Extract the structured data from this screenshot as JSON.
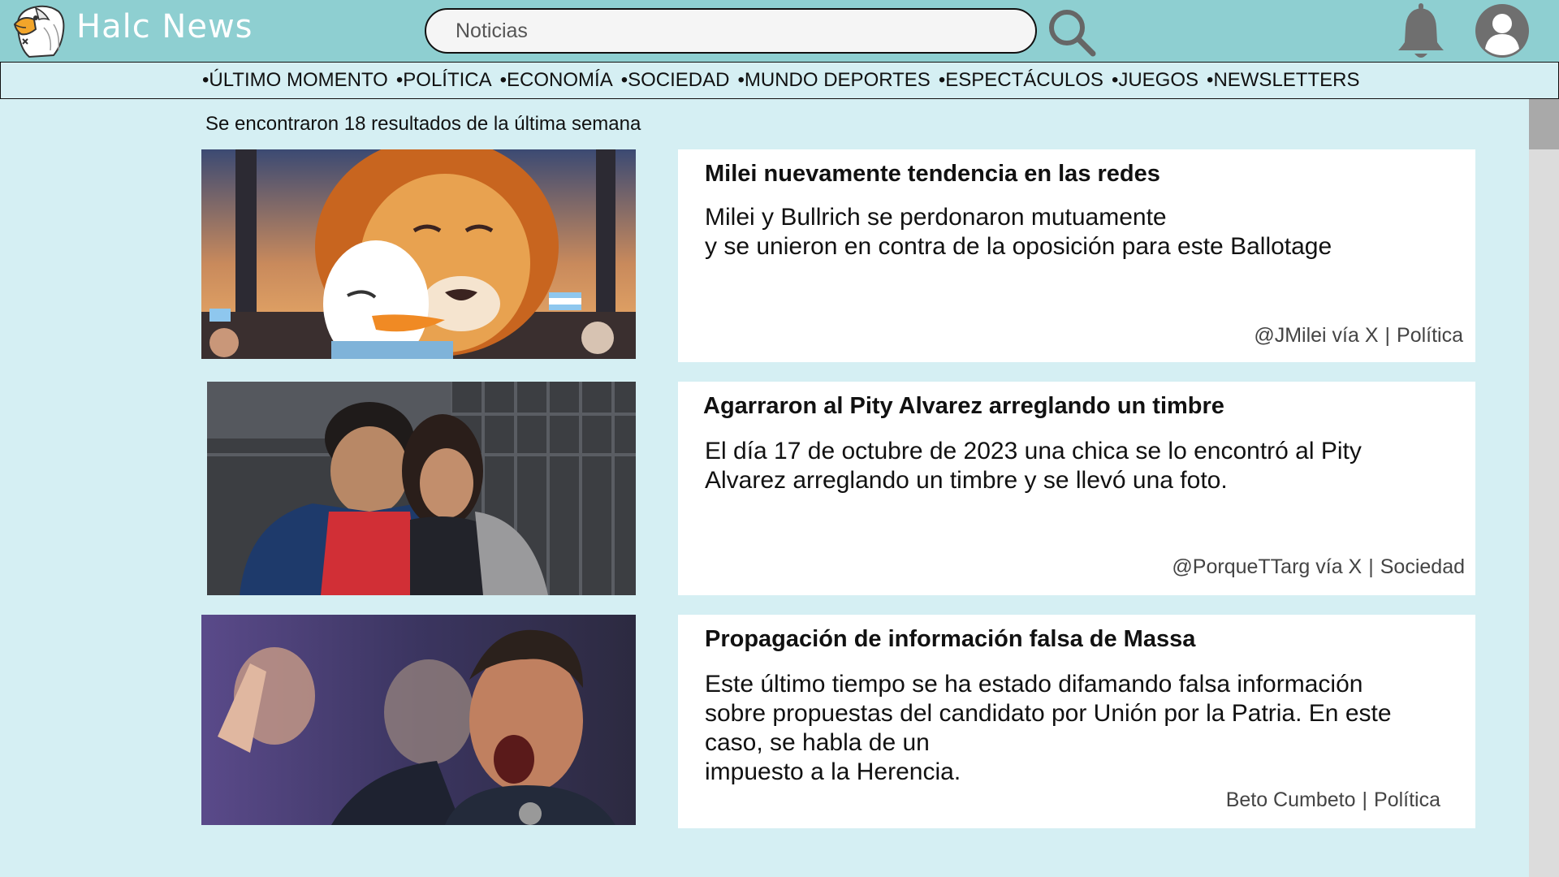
{
  "header": {
    "brand": "Halc News",
    "search_value": "Noticias",
    "icons": {
      "logo": "eagle-logo",
      "search": "search-icon",
      "notifications": "bell-icon",
      "profile": "user-avatar-icon"
    }
  },
  "nav": {
    "items": [
      "ÚLTIMO MOMENTO",
      "POLÍTICA",
      "ECONOMÍA",
      "SOCIEDAD",
      "MUNDO DEPORTES",
      "ESPECTÁCULOS",
      "JUEGOS",
      "NEWSLETTERS"
    ]
  },
  "results": {
    "count_text": "Se encontraron 18 resultados de la última semana",
    "articles": [
      {
        "title": "Milei nuevamente tendencia en las redes",
        "body": "Milei y Bullrich se perdonaron mutuamente\ny se unieron en contra de la oposición para este Ballotage",
        "source": "@JMilei vía X",
        "category": "Política",
        "image": "lion-and-duck-embrace-illustration"
      },
      {
        "title": "Agarraron al Pity Alvarez arreglando un timbre",
        "body": "El día 17 de octubre de 2023 una chica se lo encontró al Pity\nAlvarez arreglando un timbre y se llevó una foto.",
        "source": "@PorqueTTarg vía X",
        "category": "Sociedad",
        "image": "man-and-woman-selfie-photo"
      },
      {
        "title": "Propagación de información falsa de Massa",
        "body": "Este último tiempo se ha estado difamando falsa información\nsobre propuestas del candidato por Unión por la Patria. En este\ncaso, se habla de un\nimpuesto a la Herencia.",
        "source": "Beto Cumbeto",
        "category": "Política",
        "image": "politician-speaking-photo"
      }
    ]
  },
  "colors": {
    "header_bg": "#8ecfd1",
    "page_bg": "#d5eff3",
    "card_bg": "#ffffff"
  }
}
